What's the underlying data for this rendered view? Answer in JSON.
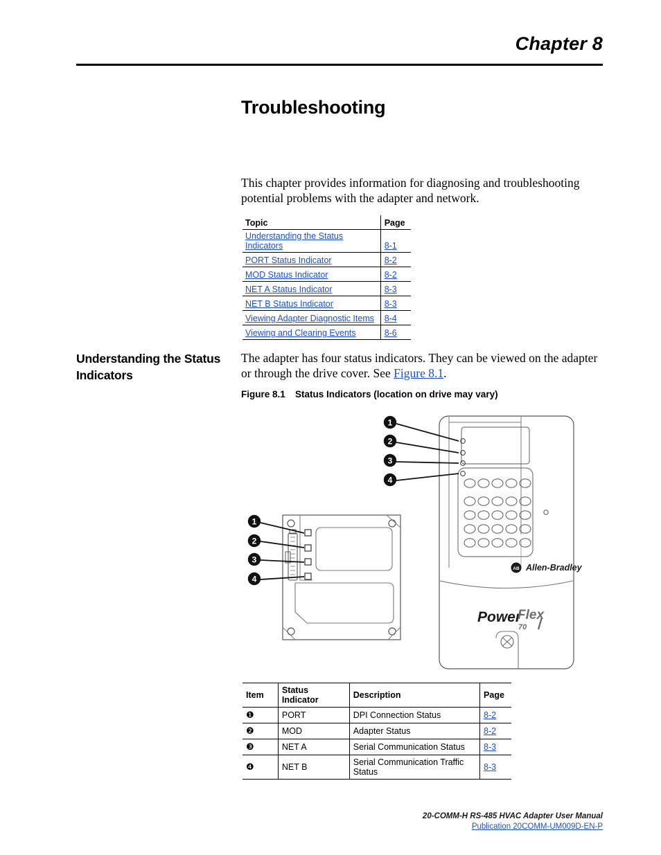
{
  "header": {
    "chapter_label": "Chapter 8",
    "title": "Troubleshooting"
  },
  "intro": {
    "paragraph": "This chapter provides information for diagnosing and troubleshooting potential problems with the adapter and network."
  },
  "toc": {
    "columns": [
      "Topic",
      "Page"
    ],
    "rows": [
      {
        "topic": "Understanding the Status Indicators",
        "page": "8-1"
      },
      {
        "topic": "PORT Status Indicator",
        "page": "8-2"
      },
      {
        "topic": "MOD Status Indicator",
        "page": "8-2"
      },
      {
        "topic": "NET A Status Indicator",
        "page": "8-3"
      },
      {
        "topic": "NET B Status Indicator",
        "page": "8-3"
      },
      {
        "topic": "Viewing Adapter Diagnostic Items",
        "page": "8-4"
      },
      {
        "topic": "Viewing and Clearing Events",
        "page": "8-6"
      }
    ]
  },
  "section": {
    "heading": "Understanding the Status Indicators",
    "body_before_link": "The adapter has four status indicators. They can be viewed on the adapter or through the drive cover. See ",
    "body_link": "Figure 8.1",
    "body_after_link": "."
  },
  "figure": {
    "number": "Figure 8.1",
    "caption": "Status Indicators (location on drive may vary)",
    "adapter_callouts": [
      "1",
      "2",
      "3",
      "4"
    ],
    "drive_callouts": [
      "1",
      "2",
      "3",
      "4"
    ],
    "drive_brand": "Allen-Bradley",
    "drive_logo_text": "A-B",
    "drive_product": "PowerFlex",
    "drive_product_series": "70"
  },
  "legend": {
    "columns": [
      "Item",
      "Status Indicator",
      "Description",
      "Page"
    ],
    "rows": [
      {
        "item": "❶",
        "indicator": "PORT",
        "description": "DPI Connection Status",
        "page": "8-2"
      },
      {
        "item": "❷",
        "indicator": "MOD",
        "description": "Adapter Status",
        "page": "8-2"
      },
      {
        "item": "❸",
        "indicator": "NET A",
        "description": "Serial Communication Status",
        "page": "8-3"
      },
      {
        "item": "❹",
        "indicator": "NET B",
        "description": "Serial Communication Traffic Status",
        "page": "8-3"
      }
    ]
  },
  "footer": {
    "manual_title": "20-COMM-H RS-485 HVAC Adapter User Manual",
    "publication": "Publication 20COMM-UM009D-EN-P"
  },
  "colors": {
    "link": "#1a4fd6",
    "text": "#000000",
    "line_art": "#3a3a3a"
  }
}
